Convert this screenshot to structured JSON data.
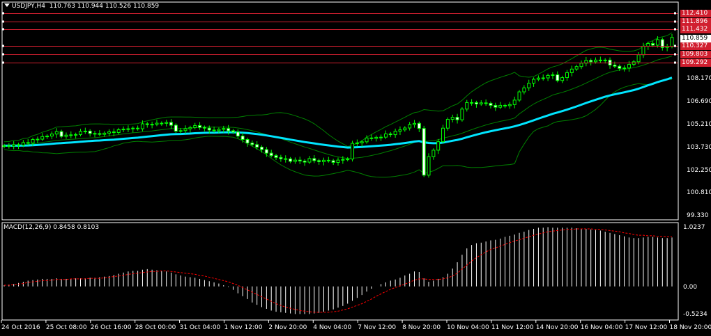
{
  "header": {
    "symbol_label": "USDJPY,H4",
    "ohlc": "110.763 110.944 110.526 110.859"
  },
  "macd": {
    "label": "MACD(12,26,9) 0.8458 0.8103",
    "axis": [
      "1.0237",
      "0.00",
      "-0.5234"
    ]
  },
  "price_axis": [
    "108.170",
    "106.690",
    "105.210",
    "103.730",
    "102.250",
    "100.810",
    "99.330"
  ],
  "price_tags": [
    {
      "text": "112.410",
      "style": "tag"
    },
    {
      "text": "111.896",
      "style": "tag"
    },
    {
      "text": "111.432",
      "style": "tag"
    },
    {
      "text": "110.859",
      "style": "cur"
    },
    {
      "text": "110.327",
      "style": "tag"
    },
    {
      "text": "109.803",
      "style": "tag"
    },
    {
      "text": "109.292",
      "style": "tag"
    }
  ],
  "time_axis": [
    "24 Oct 2016",
    "25 Oct 08:00",
    "26 Oct 16:00",
    "28 Oct 00:00",
    "31 Oct 04:00",
    "1 Nov 12:00",
    "2 Nov 20:00",
    "4 Nov 04:00",
    "7 Nov 12:00",
    "8 Nov 20:00",
    "10 Nov 04:00",
    "11 Nov 12:00",
    "14 Nov 20:00",
    "16 Nov 04:00",
    "17 Nov 12:00",
    "18 Nov 20:00"
  ],
  "colors": {
    "background": "#000000",
    "candle_up": "#00ff00",
    "candle_down": "#ffffff",
    "moving_average": "#00e5ff",
    "bollinger": "#008000",
    "level_lines": "#d11f2f",
    "macd_hist": "#ffffff",
    "macd_signal": "#ff0000"
  },
  "chart_data": {
    "type": "candlestick",
    "symbol": "USDJPY",
    "timeframe": "H4",
    "close": [
      103.88,
      103.85,
      103.95,
      103.91,
      104.08,
      104.05,
      104.28,
      104.3,
      104.47,
      104.5,
      104.63,
      104.79,
      104.48,
      104.56,
      104.58,
      104.6,
      104.8,
      104.82,
      104.67,
      104.66,
      104.61,
      104.69,
      104.77,
      104.73,
      104.91,
      104.95,
      104.97,
      105.01,
      104.97,
      105.29,
      105.24,
      105.26,
      105.33,
      105.32,
      105.38,
      105.2,
      104.82,
      104.85,
      104.97,
      105.05,
      105.18,
      105.06,
      105.01,
      104.89,
      104.85,
      104.93,
      104.99,
      104.84,
      104.76,
      104.5,
      104.28,
      104.05,
      103.95,
      103.79,
      103.63,
      103.4,
      103.24,
      103.12,
      103.04,
      103.03,
      102.87,
      102.95,
      102.89,
      102.82,
      103.05,
      102.92,
      102.85,
      102.94,
      102.91,
      102.8,
      102.95,
      102.99,
      103.02,
      104.03,
      104.06,
      104.13,
      104.38,
      104.35,
      104.42,
      104.43,
      104.64,
      104.59,
      104.81,
      104.9,
      105.02,
      105.24,
      105.32,
      104.99,
      101.98,
      103.17,
      103.59,
      104.14,
      105.01,
      105.58,
      105.71,
      105.55,
      106.24,
      106.66,
      106.66,
      106.57,
      106.64,
      106.61,
      106.48,
      106.36,
      106.48,
      106.46,
      106.53,
      106.82,
      107.35,
      107.61,
      107.91,
      108.16,
      108.24,
      108.25,
      108.41,
      108.45,
      108.08,
      108.27,
      108.59,
      108.82,
      108.98,
      109.2,
      109.38,
      109.29,
      109.4,
      109.38,
      109.4,
      109.08,
      109.0,
      108.86,
      108.89,
      109.12,
      109.29,
      109.74,
      110.29,
      110.47,
      110.36,
      110.72,
      110.21,
      110.28,
      110.86
    ]
  },
  "macd_data": {
    "hist": [
      0.02,
      0.03,
      0.04,
      0.06,
      0.08,
      0.1,
      0.11,
      0.12,
      0.13,
      0.13,
      0.13,
      0.14,
      0.13,
      0.13,
      0.13,
      0.14,
      0.14,
      0.14,
      0.15,
      0.15,
      0.16,
      0.17,
      0.18,
      0.2,
      0.22,
      0.24,
      0.26,
      0.27,
      0.27,
      0.29,
      0.3,
      0.29,
      0.28,
      0.27,
      0.26,
      0.24,
      0.21,
      0.19,
      0.17,
      0.16,
      0.15,
      0.13,
      0.11,
      0.09,
      0.07,
      0.05,
      0.02,
      -0.01,
      -0.06,
      -0.12,
      -0.17,
      -0.22,
      -0.28,
      -0.32,
      -0.36,
      -0.39,
      -0.42,
      -0.44,
      -0.45,
      -0.46,
      -0.47,
      -0.48,
      -0.48,
      -0.48,
      -0.48,
      -0.47,
      -0.46,
      -0.44,
      -0.42,
      -0.4,
      -0.37,
      -0.34,
      -0.3,
      -0.25,
      -0.2,
      -0.15,
      -0.09,
      -0.04,
      0.0,
      0.04,
      0.07,
      0.1,
      0.12,
      0.15,
      0.19,
      0.22,
      0.26,
      0.25,
      0.14,
      0.08,
      0.1,
      0.13,
      0.16,
      0.22,
      0.31,
      0.42,
      0.55,
      0.66,
      0.72,
      0.75,
      0.76,
      0.78,
      0.8,
      0.81,
      0.83,
      0.86,
      0.88,
      0.9,
      0.93,
      0.95,
      0.98,
      1.0,
      1.02,
      1.02,
      1.03,
      1.02,
      1.02,
      1.02,
      1.02,
      1.02,
      1.01,
      1.0,
      1.0,
      0.99,
      0.98,
      0.97,
      0.95,
      0.93,
      0.91,
      0.89,
      0.87,
      0.85,
      0.84,
      0.84,
      0.85,
      0.86,
      0.86,
      0.85,
      0.84,
      0.84,
      0.85
    ],
    "signal": [
      0.02,
      0.02,
      0.03,
      0.04,
      0.05,
      0.07,
      0.08,
      0.09,
      0.1,
      0.1,
      0.11,
      0.12,
      0.12,
      0.12,
      0.13,
      0.13,
      0.13,
      0.13,
      0.14,
      0.14,
      0.14,
      0.15,
      0.16,
      0.17,
      0.18,
      0.19,
      0.21,
      0.22,
      0.23,
      0.24,
      0.25,
      0.26,
      0.26,
      0.27,
      0.27,
      0.26,
      0.25,
      0.24,
      0.23,
      0.22,
      0.21,
      0.19,
      0.18,
      0.16,
      0.14,
      0.12,
      0.1,
      0.08,
      0.05,
      0.02,
      -0.02,
      -0.06,
      -0.1,
      -0.14,
      -0.18,
      -0.22,
      -0.26,
      -0.3,
      -0.33,
      -0.36,
      -0.38,
      -0.4,
      -0.42,
      -0.43,
      -0.44,
      -0.45,
      -0.45,
      -0.45,
      -0.45,
      -0.44,
      -0.43,
      -0.41,
      -0.39,
      -0.36,
      -0.33,
      -0.3,
      -0.26,
      -0.22,
      -0.17,
      -0.13,
      -0.09,
      -0.05,
      -0.02,
      0.01,
      0.04,
      0.07,
      0.11,
      0.13,
      0.13,
      0.12,
      0.12,
      0.12,
      0.13,
      0.15,
      0.18,
      0.23,
      0.3,
      0.37,
      0.44,
      0.5,
      0.55,
      0.6,
      0.64,
      0.67,
      0.7,
      0.73,
      0.76,
      0.79,
      0.81,
      0.84,
      0.86,
      0.89,
      0.91,
      0.93,
      0.95,
      0.96,
      0.97,
      0.98,
      0.99,
      0.99,
      1.0,
      1.0,
      1.0,
      1.0,
      0.99,
      0.99,
      0.98,
      0.97,
      0.96,
      0.95,
      0.93,
      0.92,
      0.9,
      0.89,
      0.89,
      0.88,
      0.88,
      0.87,
      0.87,
      0.86,
      0.86
    ]
  }
}
